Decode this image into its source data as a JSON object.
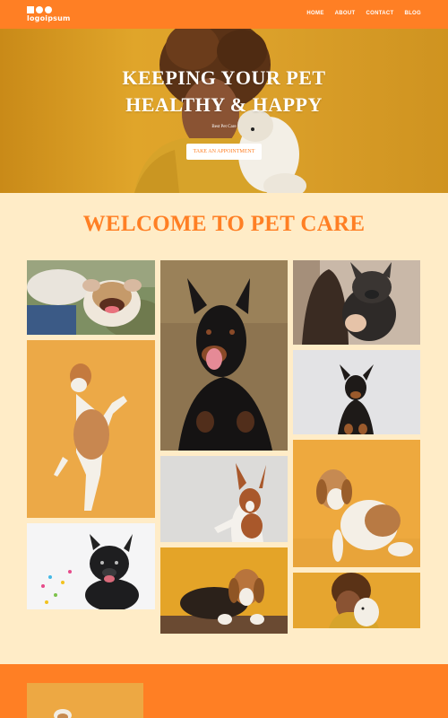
{
  "nav": {
    "logo_text": "logoipsum",
    "links": [
      "HOME",
      "ABOUT",
      "CONTACT",
      "BLOG"
    ]
  },
  "hero": {
    "title_line1": "KEEPING YOUR PET",
    "title_line2": "HEALTHY & HAPPY",
    "subtitle": "Best Pet Care",
    "cta_label": "TAKE AN APPOINTMENT"
  },
  "welcome": {
    "heading": "WELCOME TO PET CARE"
  },
  "gallery": {
    "photos": [
      "english-bulldog-photo",
      "jack-russell-standing-photo",
      "french-bulldog-confetti-photo",
      "doberman-photo",
      "basenji-photo",
      "beagle-fence-photo",
      "french-bulldog-held-photo",
      "toy-terrier-photo",
      "beagle-sitting-photo",
      "woman-with-pomeranian-photo"
    ]
  },
  "colors": {
    "accent": "#ff7f24",
    "background": "#ffecc7",
    "hero_yellow": "#e0a52a"
  }
}
